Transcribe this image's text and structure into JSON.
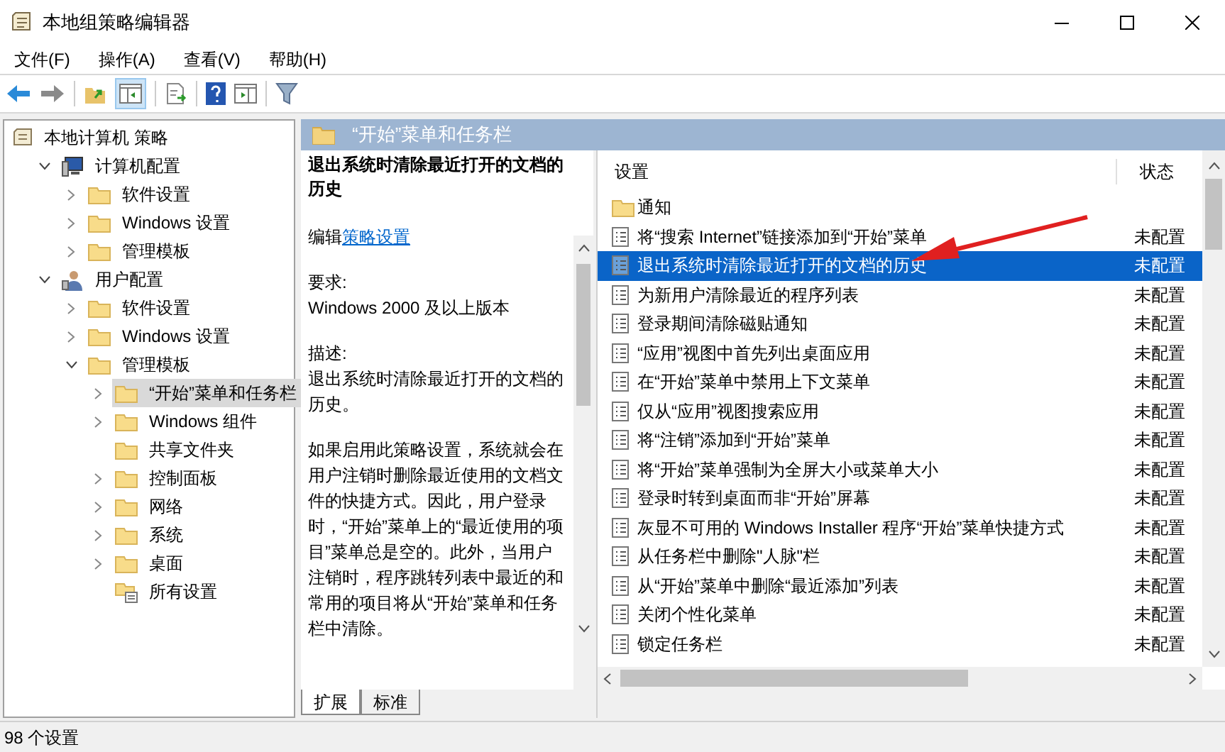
{
  "window": {
    "title": "本地组策略编辑器"
  },
  "menu": [
    "文件(F)",
    "操作(A)",
    "查看(V)",
    "帮助(H)"
  ],
  "tree": [
    {
      "label": "本地计算机 策略",
      "kind": "policy",
      "selected": false,
      "children": [
        {
          "label": "计算机配置",
          "kind": "computer",
          "expanded": true,
          "selected": false,
          "children": [
            {
              "label": "软件设置",
              "kind": "folder",
              "expanded": false,
              "selected": false
            },
            {
              "label": "Windows 设置",
              "kind": "folder",
              "expanded": false,
              "selected": false
            },
            {
              "label": "管理模板",
              "kind": "folder",
              "expanded": false,
              "selected": false
            }
          ]
        },
        {
          "label": "用户配置",
          "kind": "user",
          "expanded": true,
          "selected": false,
          "children": [
            {
              "label": "软件设置",
              "kind": "folder",
              "expanded": false,
              "selected": false
            },
            {
              "label": "Windows 设置",
              "kind": "folder",
              "expanded": false,
              "selected": false
            },
            {
              "label": "管理模板",
              "kind": "folder",
              "expanded": true,
              "selected": false,
              "children": [
                {
                  "label": "“开始”菜单和任务栏",
                  "kind": "folder",
                  "expanded": false,
                  "selected": true
                },
                {
                  "label": "Windows 组件",
                  "kind": "folder",
                  "expanded": false,
                  "selected": false
                },
                {
                  "label": "共享文件夹",
                  "kind": "folder",
                  "selected": false
                },
                {
                  "label": "控制面板",
                  "kind": "folder",
                  "expanded": false,
                  "selected": false
                },
                {
                  "label": "网络",
                  "kind": "folder",
                  "expanded": false,
                  "selected": false
                },
                {
                  "label": "系统",
                  "kind": "folder",
                  "expanded": false,
                  "selected": false
                },
                {
                  "label": "桌面",
                  "kind": "folder",
                  "expanded": false,
                  "selected": false
                },
                {
                  "label": "所有设置",
                  "kind": "all",
                  "selected": false
                }
              ]
            }
          ]
        }
      ]
    }
  ],
  "header": {
    "title": "“开始”菜单和任务栏"
  },
  "description": {
    "title": "退出系统时清除最近打开的文档的历史",
    "edit_prefix": "编辑",
    "edit_link": "策略设置",
    "requirements_label": "要求:",
    "requirements": "Windows 2000 及以上版本",
    "description_label": "描述:",
    "description": "退出系统时清除最近打开的文档的历史。",
    "body": "如果启用此策略设置，系统就会在用户注销时删除最近使用的文档文件的快捷方式。因此，用户登录时，“开始”菜单上的“最近使用的项目”菜单总是空的。此外，当用户注销时，程序跳转列表中最近的和常用的项目将从“开始”菜单和任务栏中清除。"
  },
  "list": {
    "columns": [
      "设置",
      "状态"
    ],
    "rows": [
      {
        "kind": "folder",
        "name": "通知",
        "selected": false
      },
      {
        "kind": "setting",
        "name": "将“搜索 Internet”链接添加到“开始”菜单",
        "state": "未配置",
        "selected": false
      },
      {
        "kind": "setting",
        "name": "退出系统时清除最近打开的文档的历史",
        "state": "未配置",
        "selected": true
      },
      {
        "kind": "setting",
        "name": "为新用户清除最近的程序列表",
        "state": "未配置",
        "selected": false
      },
      {
        "kind": "setting",
        "name": "登录期间清除磁贴通知",
        "state": "未配置",
        "selected": false
      },
      {
        "kind": "setting",
        "name": "“应用”视图中首先列出桌面应用",
        "state": "未配置",
        "selected": false
      },
      {
        "kind": "setting",
        "name": "在“开始”菜单中禁用上下文菜单",
        "state": "未配置",
        "selected": false
      },
      {
        "kind": "setting",
        "name": "仅从“应用”视图搜索应用",
        "state": "未配置",
        "selected": false
      },
      {
        "kind": "setting",
        "name": "将“注销”添加到“开始”菜单",
        "state": "未配置",
        "selected": false
      },
      {
        "kind": "setting",
        "name": "将“开始”菜单强制为全屏大小或菜单大小",
        "state": "未配置",
        "selected": false
      },
      {
        "kind": "setting",
        "name": "登录时转到桌面而非“开始”屏幕",
        "state": "未配置",
        "selected": false
      },
      {
        "kind": "setting",
        "name": "灰显不可用的 Windows Installer 程序“开始”菜单快捷方式",
        "state": "未配置",
        "selected": false
      },
      {
        "kind": "setting",
        "name": "从任务栏中删除\"人脉\"栏",
        "state": "未配置",
        "selected": false
      },
      {
        "kind": "setting",
        "name": "从“开始”菜单中删除“最近添加”列表",
        "state": "未配置",
        "selected": false
      },
      {
        "kind": "setting",
        "name": "关闭个性化菜单",
        "state": "未配置",
        "selected": false
      },
      {
        "kind": "setting",
        "name": "锁定任务栏",
        "state": "未配置",
        "selected": false
      }
    ]
  },
  "view_tabs": [
    {
      "label": "扩展",
      "selected": true
    },
    {
      "label": "标准",
      "selected": false
    }
  ],
  "status_bar": "98 个设置"
}
